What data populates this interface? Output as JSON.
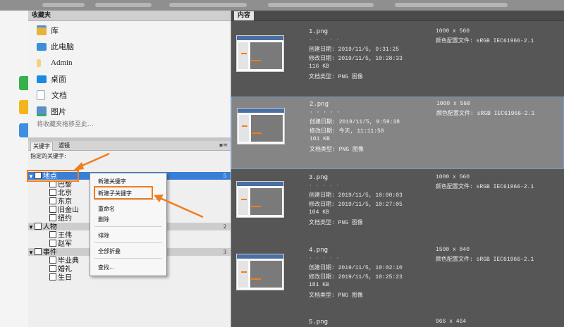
{
  "favorites": {
    "header": "收藏夹",
    "items": [
      {
        "label": "库",
        "icon": "library-icon"
      },
      {
        "label": "此电脑",
        "icon": "computer-icon"
      },
      {
        "label": "Admin",
        "icon": "folder-icon"
      },
      {
        "label": "桌面",
        "icon": "desktop-icon"
      },
      {
        "label": "文档",
        "icon": "document-icon"
      },
      {
        "label": "图片",
        "icon": "pictures-icon"
      }
    ],
    "hint": "将收藏夹拖移至此..."
  },
  "keywords": {
    "tabs": [
      "关键字",
      "滤镜"
    ],
    "label": "指定的关键字:",
    "groups": [
      {
        "name": "地点",
        "count": "5",
        "children": [
          "巴黎",
          "北京",
          "东京",
          "旧金山",
          "纽约"
        ]
      },
      {
        "name": "人物",
        "count": "2",
        "children": [
          "王伟",
          "赵军"
        ]
      },
      {
        "name": "事件",
        "count": "3",
        "children": [
          "毕业典",
          "婚礼",
          "生日"
        ]
      }
    ]
  },
  "context_menu": {
    "items": [
      "新建关键字",
      "新建子关键字",
      "重命名",
      "删除",
      "排除",
      "全部折叠",
      "查找..."
    ]
  },
  "content": {
    "tab": "内容",
    "field_labels": {
      "created": "创建日期:",
      "modified": "修改日期:",
      "type": "文档类型:",
      "profile": "颜色配置文件:"
    },
    "files": [
      {
        "name": "1.png",
        "created": "2019/11/5, 9:31:25",
        "modified": "2019/11/5, 10:28:33",
        "size": "116 KB",
        "type": "PNG 图像",
        "dims": "1000 x 560",
        "profile": "sRGB IEC61966-2.1"
      },
      {
        "name": "2.png",
        "created": "2019/11/5, 9:59:38",
        "modified": "今天, 11:11:50",
        "size": "101 KB",
        "type": "PNG 图像",
        "dims": "1000 x 560",
        "profile": "sRGB IEC61966-2.1"
      },
      {
        "name": "3.png",
        "created": "2019/11/5, 10:00:03",
        "modified": "2019/11/5, 10:27:05",
        "size": "104 KB",
        "type": "PNG 图像",
        "dims": "1000 x 560",
        "profile": "sRGB IEC61966-2.1"
      },
      {
        "name": "4.png",
        "created": "2019/11/5, 10:02:10",
        "modified": "2019/11/5, 10:25:23",
        "size": "181 KB",
        "type": "PNG 图像",
        "dims": "1500 x 840",
        "profile": "sRGB IEC61966-2.1"
      },
      {
        "name": "5.png",
        "dims": "966 x 464"
      }
    ]
  },
  "colors": {
    "selection": "#3a7fd6",
    "highlight": "#f07d1f",
    "content_bg": "#565656"
  }
}
